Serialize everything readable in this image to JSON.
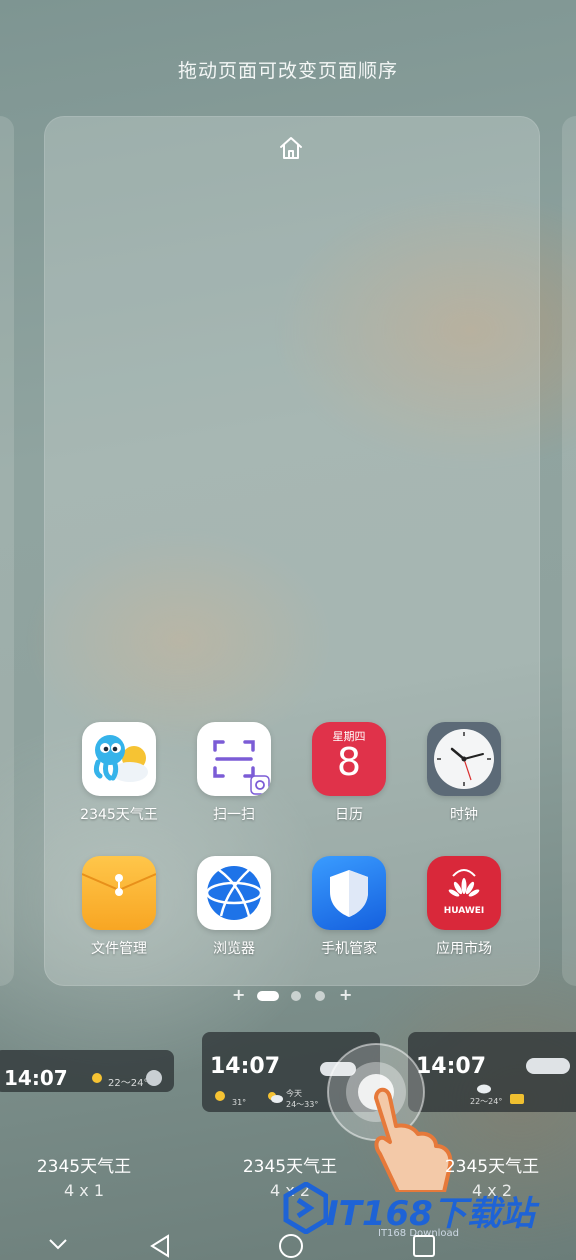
{
  "hint": "拖动页面可改变页面顺序",
  "apps": [
    {
      "label": "2345天气王",
      "icon": "weather-octopus-icon"
    },
    {
      "label": "扫一扫",
      "icon": "scan-icon"
    },
    {
      "label": "日历",
      "icon": "calendar-icon",
      "weekday": "星期四",
      "day": "8"
    },
    {
      "label": "时钟",
      "icon": "clock-icon"
    },
    {
      "label": "文件管理",
      "icon": "folder-icon"
    },
    {
      "label": "浏览器",
      "icon": "browser-icon"
    },
    {
      "label": "手机管家",
      "icon": "shield-icon"
    },
    {
      "label": "应用市场",
      "icon": "huawei-appgallery-icon",
      "brand": "HUAWEI"
    }
  ],
  "widgets": [
    {
      "name": "2345天气王",
      "size": "4 x 1",
      "time": "14:07",
      "temp": "22～24°"
    },
    {
      "name": "2345天气王",
      "size": "4 x 2",
      "time": "14:07",
      "today": "今天",
      "today_temp": "24～33°",
      "temp2": "31°"
    },
    {
      "name": "2345天气王",
      "size": "4 x 2",
      "time": "14:07",
      "temp": "22～24°"
    }
  ],
  "watermark": {
    "text": "IT168下载站",
    "sub": "IT168 Download"
  },
  "colors": {
    "accent_blue": "#1e63d6",
    "calendar_red": "#e0324a",
    "appgallery_red": "#d9283a"
  }
}
